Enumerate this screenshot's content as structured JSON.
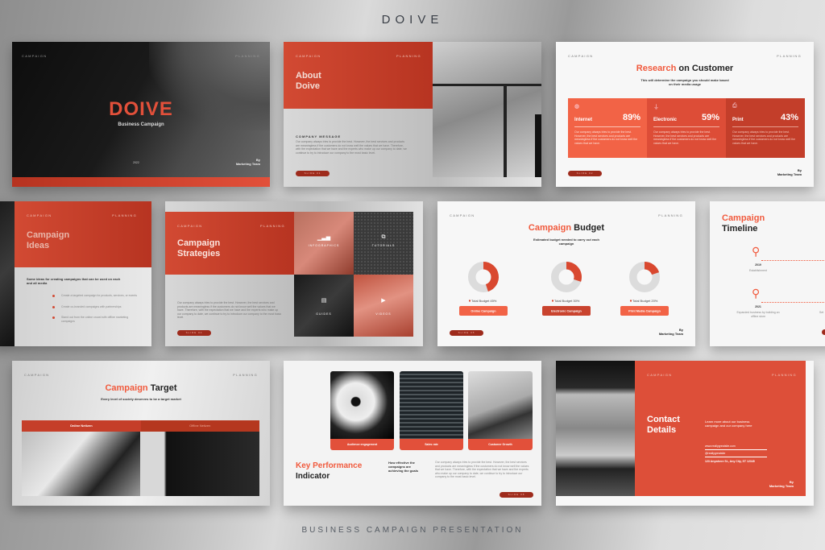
{
  "brand": "DOIVE",
  "footer_title": "BUSINESS CAMPAIGN PRESENTATION",
  "colors": {
    "accent": "#f15a3d",
    "red": "#d24a33",
    "dark_red": "#9e2b1c",
    "text_dark": "#222222"
  },
  "common": {
    "tag_left": "CAMPAIGN",
    "tag_right": "PLANNING",
    "byline_by": "By",
    "byline_team": "Marketing Team"
  },
  "slides": {
    "cover": {
      "title": "DOIVE",
      "subtitle": "Business Campaign",
      "year": "2022"
    },
    "about": {
      "title_line1": "About",
      "title_line2": "Doive",
      "section_label": "COMPANY MESSAGE",
      "body": "Our company always tries to provide the best. However, the best services and products are meaningless if the customers do not know well the values that we have. Therefore, with the expectation that we have and the experts who make up our company to date, we continue to try to introduce our company to the most basic level.",
      "pill": "SLIDE 01"
    },
    "research": {
      "title_accent": "Research",
      "title_rest": "on Customer",
      "subtitle": "This will determine the campaign you should make based on their media usage",
      "pill": "SLIDE 02",
      "cards": [
        {
          "icon": "globe-icon",
          "label": "Internet",
          "value": "89%",
          "text": "Our company always tries to provide the best. However, the best services and products are meaningless if the customers do not know well the values that we have."
        },
        {
          "icon": "plug-icon",
          "label": "Electronic",
          "value": "59%",
          "text": "Our company always tries to provide the best. However, the best services and products are meaningless if the customers do not know well the values that we have."
        },
        {
          "icon": "printer-icon",
          "label": "Print",
          "value": "43%",
          "text": "Our company always tries to provide the best. However, the best services and products are meaningless if the customers do not know well the values that we have."
        }
      ]
    },
    "ideas": {
      "title_line1": "Campaign",
      "title_line2": "Ideas",
      "lead": "Some ideas for creating campaigns that can be used on each and all media",
      "items": [
        "Create a targeted campaign for products, services, or events",
        "Create co-branded campaigns with partnerships",
        "Stand out from the online crowd with offline marketing campaigns"
      ]
    },
    "strategies": {
      "title_line1": "Campaign",
      "title_line2": "Strategies",
      "body": "Our company always tries to provide the best. However, the best services and products are meaningless if the customers do not know well the values that we have. Therefore, with the expectation that we have and the experts who make up our company to date, we continue to try to introduce our company to the most basic level.",
      "pill": "SLIDE 04",
      "tiles": [
        {
          "icon": "chart-icon",
          "label": "INFOGRAPHICS"
        },
        {
          "icon": "gallery-icon",
          "label": "TUTORIALS"
        },
        {
          "icon": "document-icon",
          "label": "GUIDES"
        },
        {
          "icon": "video-icon",
          "label": "VIDEOS"
        }
      ]
    },
    "budget": {
      "title_accent": "Campaign",
      "title_rest": "Budget",
      "subtitle": "Estimated budget needed to carry out each campaign",
      "pill": "SLIDE 05",
      "chart_data": {
        "type": "pie",
        "title": "Campaign Budget",
        "series": [
          {
            "name": "Online Campaign",
            "value": 45,
            "legend": "Total Budget 45%"
          },
          {
            "name": "Electronic Campaign",
            "value": 30,
            "legend": "Total Budget 30%"
          },
          {
            "name": "Print Media Campaign",
            "value": 20,
            "legend": "Total Budget 20%"
          }
        ]
      }
    },
    "timeline": {
      "title_line1": "Campaign",
      "title_line2": "Timeline",
      "events": [
        {
          "year": "2019",
          "text": "Establishment"
        },
        {
          "year": "2021",
          "text": "Expanded business by building an offline store"
        }
      ],
      "partial_label": "Set"
    },
    "target": {
      "title_accent": "Campaign",
      "title_rest": "Target",
      "subtitle": "Every level of society deserves to be a target market",
      "segments": [
        "Online Netizen",
        "Offline Netizen"
      ]
    },
    "kpi": {
      "cards": [
        "Audience engagement",
        "Sales rate",
        "Customer Growth"
      ],
      "title_line1": "Key Performance",
      "title_line2": "Indicator",
      "question": "How effective the campaigns are achieving the goals",
      "body": "Our company always tries to provide the best. However, the best services and products are meaningless if the customers do not know well the values that we have. Therefore, with the expectation that we have and the experts who make up our company to date, we continue to try to introduce our company to the most basic level.",
      "pill": "SLIDE 08"
    },
    "contact": {
      "title_line1": "Contact",
      "title_line2": "Details",
      "lead": "Learn more about our business campaign and our company here",
      "website": "www.reallygreatsite.com",
      "handle": "@reallygreatsite",
      "address": "123 Anywhere St., Any City, ST 12345"
    }
  }
}
